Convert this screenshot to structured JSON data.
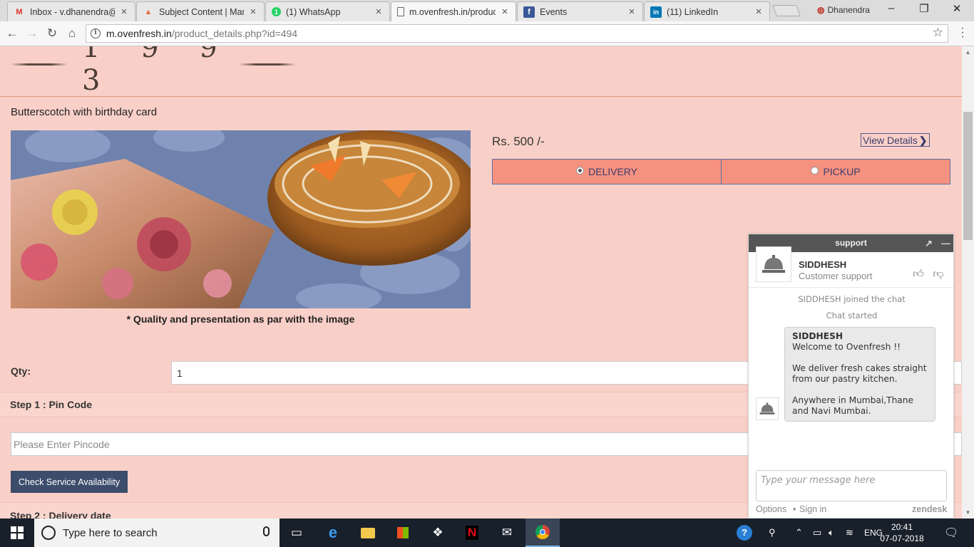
{
  "browser": {
    "tabs": [
      {
        "label": "Inbox - v.dhanendra@",
        "favicon": "gmail-icon",
        "favicon_color": "#d93025",
        "glyph": "M"
      },
      {
        "label": "Subject Content | Man",
        "favicon": "cake-icon",
        "favicon_color": "#e0703a",
        "glyph": "▲"
      },
      {
        "label": "(1) WhatsApp",
        "favicon": "whatsapp-icon",
        "favicon_color": "#25d366",
        "glyph": "1"
      },
      {
        "label": "m.ovenfresh.in/produc",
        "favicon": "page-icon",
        "favicon_color": "#666666",
        "glyph": "▯"
      },
      {
        "label": "Events",
        "favicon": "facebook-icon",
        "favicon_color": "#3b5998",
        "glyph": "f"
      },
      {
        "label": "(11) LinkedIn",
        "favicon": "linkedin-icon",
        "favicon_color": "#0077b5",
        "glyph": "in"
      }
    ],
    "profile_name": "Dhanendra",
    "url_host": "m.ovenfresh.in",
    "url_path": "/product_details.php?id=494"
  },
  "page": {
    "logo_year": "1 9 9 3",
    "product_title": "Butterscotch with birthday card",
    "image_caption": "* Quality and presentation as par with the image",
    "price": "Rs. 500 /-",
    "view_details_label": "View Details",
    "delivery_modes": [
      {
        "label": "DELIVERY",
        "selected": true
      },
      {
        "label": "PICKUP",
        "selected": false
      }
    ],
    "qty_label": "Qty:",
    "qty_value": "1",
    "step1_label": "Step 1 : Pin Code",
    "pincode_placeholder": "Please Enter Pincode",
    "check_button_label": "Check Service Availability",
    "step2_label": "Step 2 : Delivery date"
  },
  "chat": {
    "header_title": "support",
    "agent_name": "SIDDHESH",
    "agent_role": "Customer support",
    "system_messages": [
      "SIDDHESH joined the chat",
      "Chat started"
    ],
    "message": {
      "sender": "SIDDHESH",
      "paragraphs": [
        "Welcome to Ovenfresh !!",
        "We deliver fresh cakes straight from our pastry kitchen.",
        "Anywhere in Mumbai,Thane and Navi Mumbai."
      ]
    },
    "input_placeholder": "Type your message here",
    "footer_options": "Options",
    "footer_separator": "•",
    "footer_signin": "Sign in",
    "footer_brand": "zendesk"
  },
  "taskbar": {
    "search_placeholder": "Type here to search",
    "language": "ENG",
    "time": "20:41",
    "date": "07-07-2018"
  }
}
